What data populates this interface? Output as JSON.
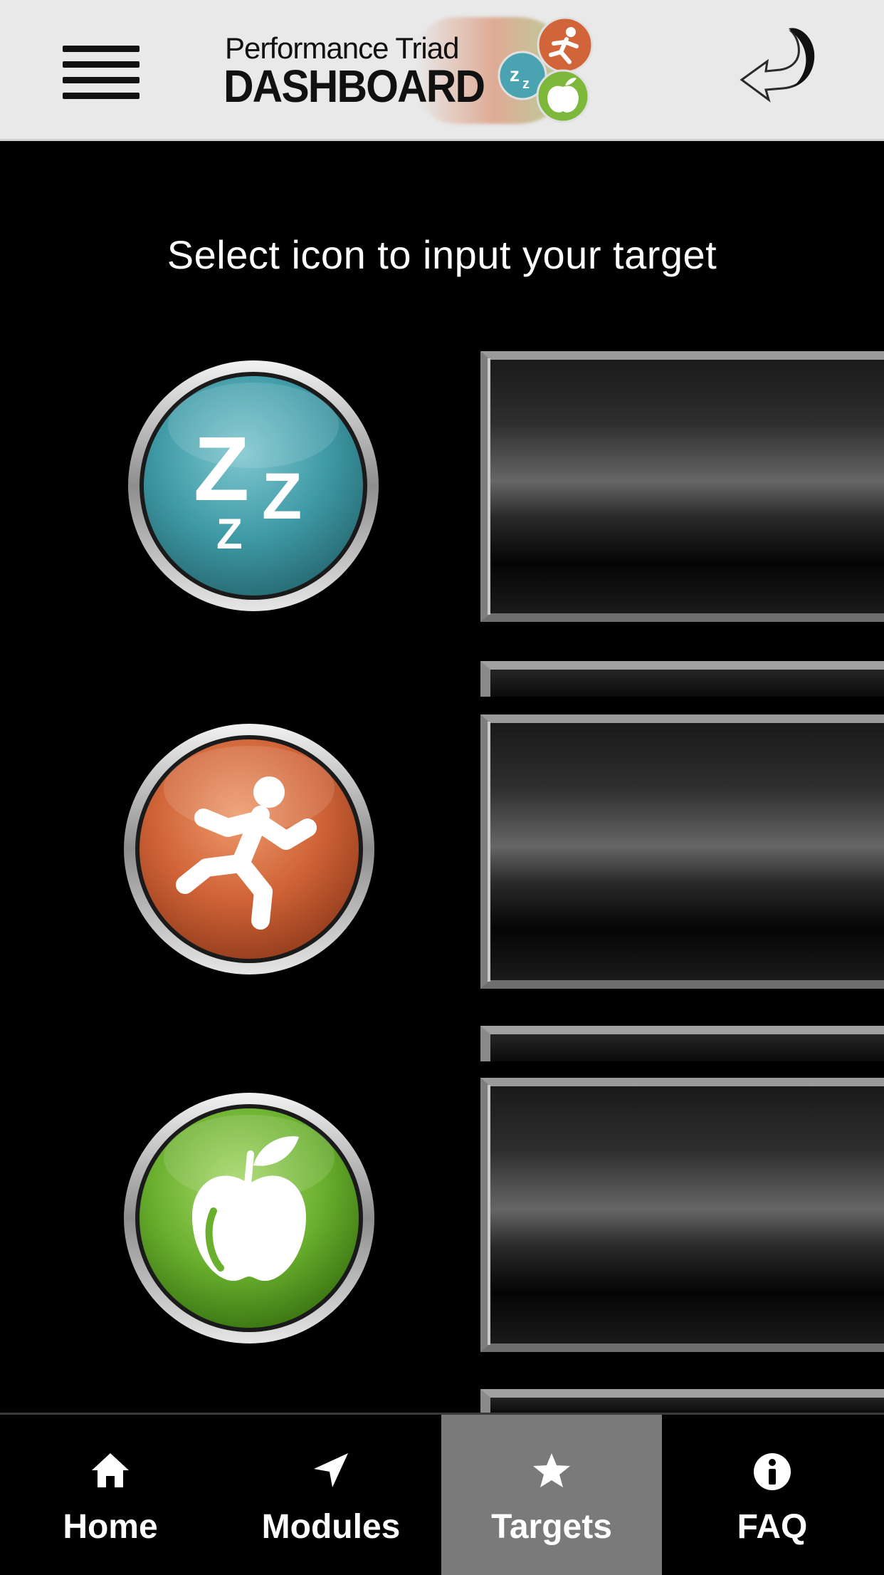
{
  "header": {
    "logo_line1": "Performance Triad",
    "logo_line2": "DASHBOARD",
    "menu_icon": "hamburger-menu-icon",
    "back_icon": "back-arrow-icon"
  },
  "instruction": "Select icon to input your target",
  "targets": [
    {
      "name": "sleep",
      "icon": "sleep-zzz-icon",
      "color": "#4aa3b0"
    },
    {
      "name": "activity",
      "icon": "running-person-icon",
      "color": "#d2643a"
    },
    {
      "name": "nutrition",
      "icon": "apple-icon",
      "color": "#7db83a"
    }
  ],
  "tabs": [
    {
      "label": "Home",
      "icon": "home-icon"
    },
    {
      "label": "Modules",
      "icon": "location-arrow-icon"
    },
    {
      "label": "Targets",
      "icon": "star-icon",
      "active": true
    },
    {
      "label": "FAQ",
      "icon": "info-icon"
    }
  ],
  "colors": {
    "header_bg": "#e9e9e9",
    "body_bg": "#000000",
    "active_tab_bg": "#7a7a7a"
  }
}
